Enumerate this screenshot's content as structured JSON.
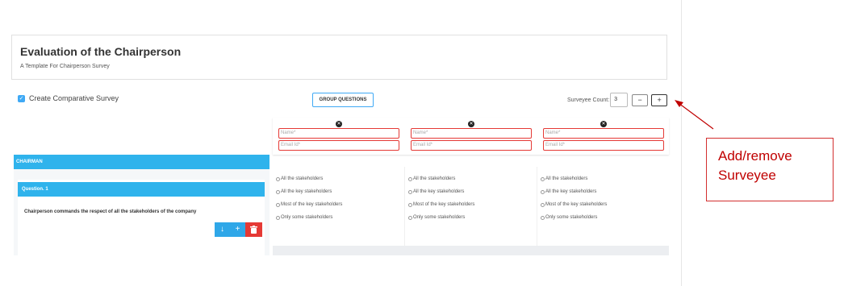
{
  "header": {
    "title": "Evaluation of the Chairperson",
    "subtitle": "A Template For Chairperson Survey"
  },
  "toolbar": {
    "comparative_label": "Create Comparative Survey",
    "comparative_checked": true,
    "group_questions_label": "GROUP QUESTIONS",
    "surveyee_count_label": "Surveyee Count:",
    "surveyee_count_value": "3",
    "minus_label": "−",
    "plus_label": "+"
  },
  "surveyees": [
    {
      "name_placeholder": "Name*",
      "email_placeholder": "Email Id*"
    },
    {
      "name_placeholder": "Name*",
      "email_placeholder": "Email Id*"
    },
    {
      "name_placeholder": "Name*",
      "email_placeholder": "Email Id*"
    }
  ],
  "section": {
    "label": "CHAIRMAN",
    "question": {
      "number_label": "Question. 1",
      "text": "Chairperson commands the respect of all the stakeholders of the company",
      "options": [
        "All the stakeholders",
        "All the key stakeholders",
        "Most of the key stakeholders",
        "Only some stakeholders"
      ]
    }
  },
  "annotation": {
    "line1": "Add/remove",
    "line2": "Surveyee",
    "color": "#c00000"
  },
  "colors": {
    "accent": "#2fb3ec",
    "danger": "#e53935"
  }
}
